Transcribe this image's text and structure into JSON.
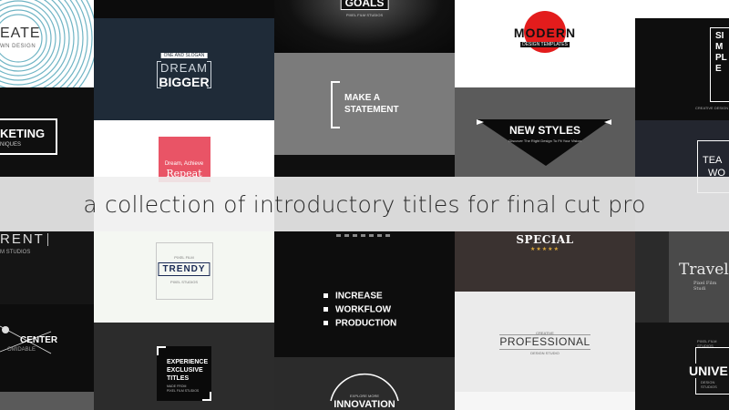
{
  "banner": {
    "caption": "a collection of introductory titles for final cut pro"
  },
  "col1": {
    "create_main": "EATE",
    "create_sub": "WN DESIGN",
    "marketing_main": "KETING",
    "marketing_sub": "NIQUES",
    "rent_main": "RENT",
    "rent_sub": "M STUDIOS",
    "center_main": "CENTER",
    "center_sub": "OMIDABLE"
  },
  "col2": {
    "dream_small": "ONE AND SLOGAN",
    "dream_line1": "DREAM",
    "dream_line2": "BIGGER",
    "card_line1": "Dream, Achieve",
    "card_line2": "Repeat",
    "trendy_top": "PIXEL FILM",
    "trendy_main": "TRENDY",
    "trendy_bottom": "PIXEL STUDIOS",
    "exp_line1": "EXPERIENCE",
    "exp_line2": "EXCLUSIVE",
    "exp_line3": "TITLES",
    "exp_sub1": "MADE FROM",
    "exp_sub2": "PIXEL FILM STUDIOS"
  },
  "col3": {
    "goals_main": "GOALS",
    "goals_sub": "PIXEL FILM STUDIOS",
    "make_line1": "MAKE A",
    "make_line2": "STATEMENT",
    "bullets": [
      "INCREASE",
      "WORKFLOW",
      "PRODUCTION"
    ],
    "innov_small": "EXPLORE MORE",
    "innov_main": "INNOVATION"
  },
  "col4": {
    "modern_main": "MODERN",
    "modern_sub": "DESIGN TEMPLATES",
    "newstyles_main": "NEW STYLES",
    "newstyles_sub": "Discover The Right Design To Fit Your Vision",
    "special_main": "SPECIAL",
    "stars": "★★★★★",
    "prof_small": "CREATIVE",
    "prof_main": "PROFESSIONAL",
    "prof_sub": "DESIGN STUDIO"
  },
  "col5": {
    "simple_main": "SIMPLE",
    "simple_sub": "CREATIVE DESIGN",
    "team_line1": "TEA",
    "team_line2": "WO",
    "travel_main": "Travel",
    "travel_sub": "Pixel Film Studi",
    "univ_small": "PIXEL FILM STUDIOS",
    "univ_main": "UNIVE",
    "univ_sub": "DESIGN STUDIOS"
  },
  "colors": {
    "red": "#e31c1c",
    "navy": "#1f2b38",
    "pink": "#e95466",
    "teal_lines": "#6fb4c4",
    "brown": "#3a3230"
  },
  "icons": [
    "star-icon",
    "square-bullet-icon",
    "triangle-banner-shape",
    "x-lines-shape",
    "concentric-rings-shape"
  ]
}
